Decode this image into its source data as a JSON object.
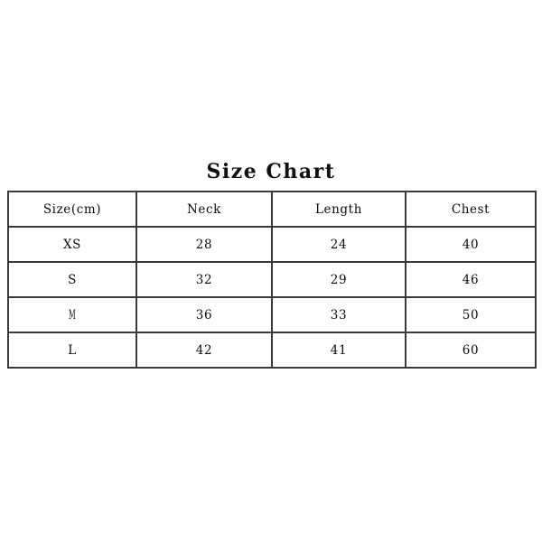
{
  "document": {
    "title": "Size Chart",
    "background_color": "#ffffff",
    "text_color": "#0c0c0c",
    "border_color": "#3a3a3a"
  },
  "table": {
    "headers": [
      "Size(cm)",
      "Neck",
      "Length",
      "Chest"
    ],
    "rows": [
      {
        "size": "XS",
        "neck": "28",
        "length": "24",
        "chest": "40"
      },
      {
        "size": "S",
        "neck": "32",
        "length": "29",
        "chest": "46"
      },
      {
        "size": "M",
        "neck": "36",
        "length": "33",
        "chest": "50"
      },
      {
        "size": "L",
        "neck": "42",
        "length": "41",
        "chest": "60"
      }
    ]
  }
}
